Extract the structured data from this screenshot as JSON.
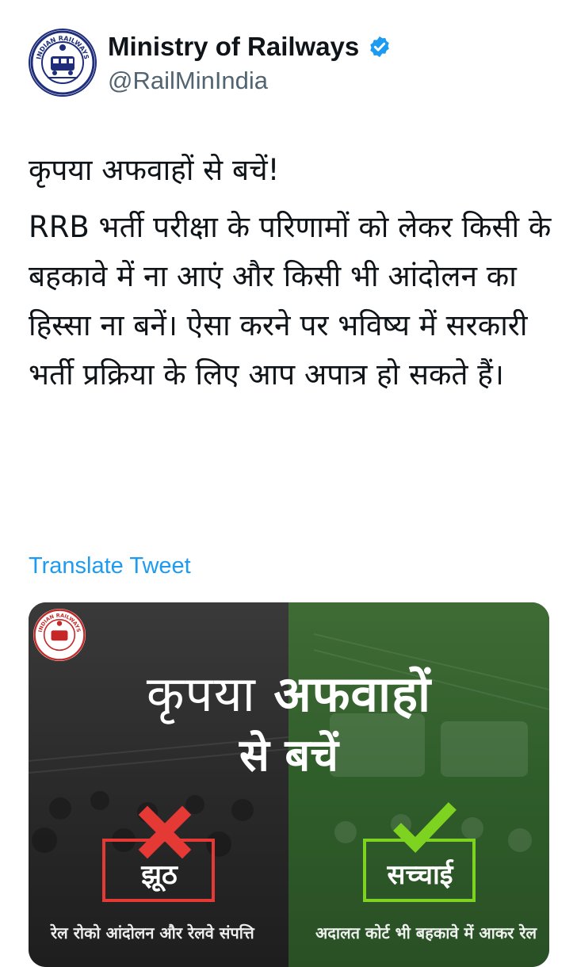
{
  "account": {
    "display_name": "Ministry of Railways",
    "handle": "@RailMinIndia",
    "verified": true,
    "avatar": "indian-railways-logo",
    "logo_text": "INDIAN RAILWAYS",
    "logo_text_hindi": "भारतीय रेल"
  },
  "tweet": {
    "line1": "कृपया अफवाहों से बचें!",
    "body": "RRB भर्ती परीक्षा के परिणामों को लेकर किसी के बहकावे में ना आएं और किसी भी आंदोलन का हिस्सा ना बनें। ऐसा करने पर भविष्य में सरकारी भर्ती प्रक्रिया के लिए आप अपात्र हो सकते हैं।"
  },
  "translate_label": "Translate Tweet",
  "media": {
    "title_line1_a": "कृपया",
    "title_line1_b": "अफवाहों",
    "title_line2": "से बचें",
    "false_label": "झूठ",
    "true_label": "सच्चाई",
    "caption_left": "रेल रोको आंदोलन और रेलवे संपत्ति",
    "caption_right": "अदालत कोर्ट भी बहकावे में आकर रेल",
    "false_icon": "cross-icon",
    "true_icon": "check-icon",
    "colors": {
      "left_overlay": "#2a2a2a",
      "right_overlay": "#2f5d2a",
      "cross": "#e53935",
      "check": "#7ed321",
      "box_red": "#e53935",
      "box_green": "#7ed321"
    }
  },
  "colors": {
    "link": "#1d9bf0",
    "verified": "#1d9bf0",
    "handle": "#536471"
  }
}
